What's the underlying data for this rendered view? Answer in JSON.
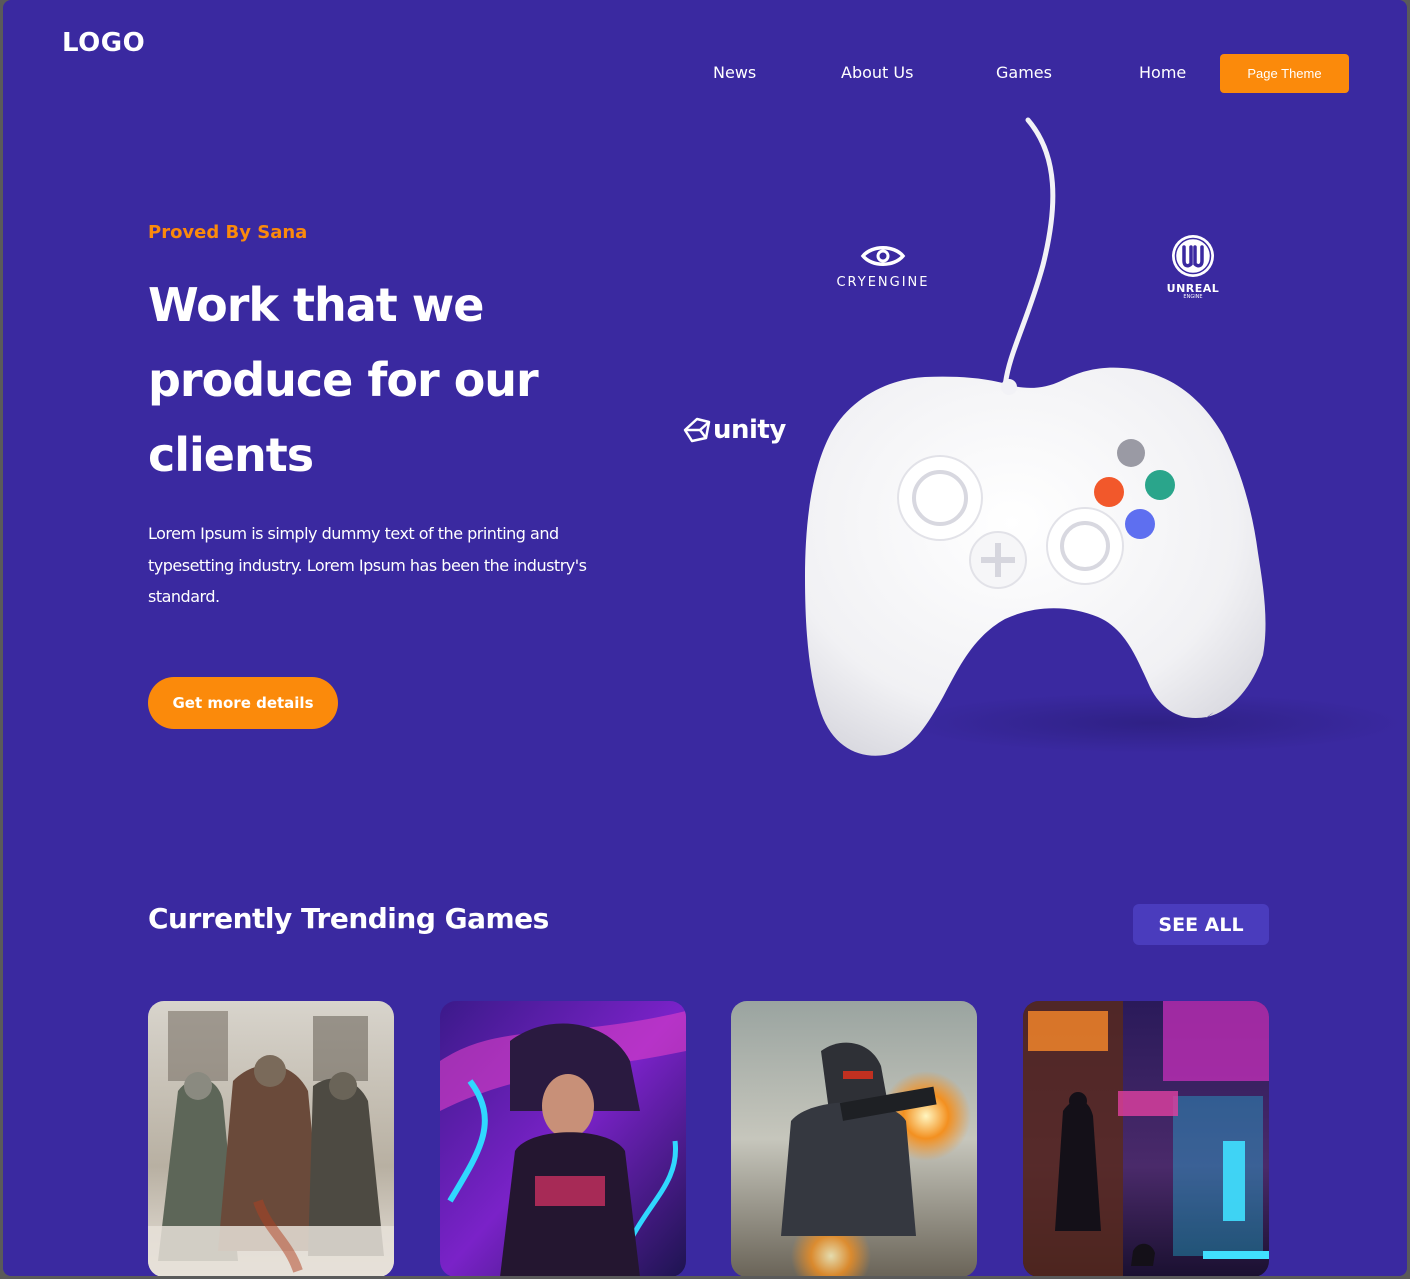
{
  "header": {
    "logo": "LOGO",
    "nav": [
      {
        "label": "News"
      },
      {
        "label": "About Us"
      },
      {
        "label": "Games"
      },
      {
        "label": "Home"
      }
    ],
    "theme_button": "Page Theme"
  },
  "hero": {
    "tagline": "Proved By Sana",
    "title": "Work that we produce for our clients",
    "description": "Lorem Ipsum is simply dummy text of the printing and typesetting industry. Lorem Ipsum has been the industry's standard.",
    "cta": "Get more details",
    "brands": {
      "cryengine": "CRYENGINE",
      "unreal": "UNREAL",
      "unreal_sub": "ENGINE",
      "unity": "unity"
    }
  },
  "trending": {
    "title": "Currently Trending Games",
    "see_all": "SEE ALL"
  },
  "colors": {
    "background": "#3a29a0",
    "accent": "#fb8a0b",
    "secondary_button": "#4a3cbd",
    "text": "#ffffff"
  }
}
